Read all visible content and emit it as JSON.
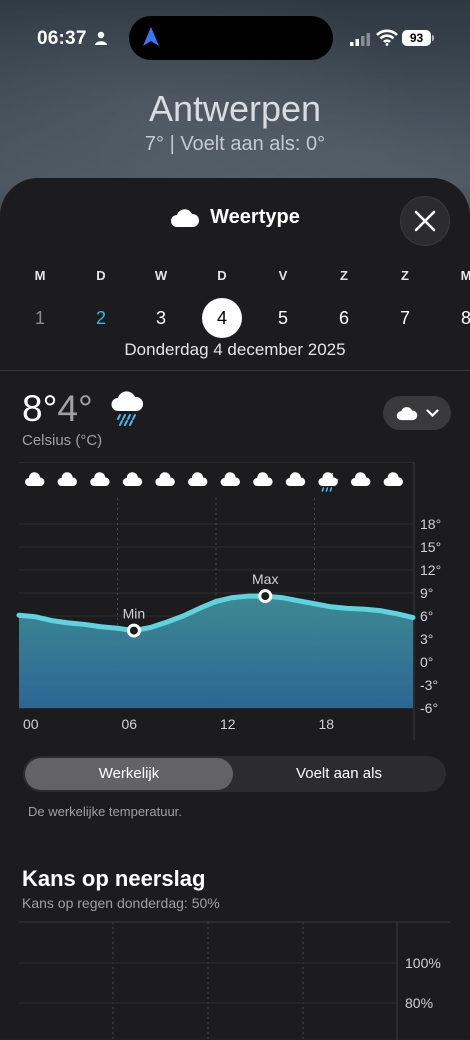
{
  "status": {
    "time": "06:37",
    "battery": "93"
  },
  "location": {
    "city": "Antwerpen",
    "summary": "7°  |  Voelt aan als: 0°"
  },
  "sheet": {
    "title": "Weertype",
    "close_icon": "close-icon"
  },
  "days": [
    {
      "letter": "M",
      "num": "1",
      "state": "past"
    },
    {
      "letter": "D",
      "num": "2",
      "state": "today"
    },
    {
      "letter": "W",
      "num": "3",
      "state": "normal"
    },
    {
      "letter": "D",
      "num": "4",
      "state": "selected"
    },
    {
      "letter": "V",
      "num": "5",
      "state": "normal"
    },
    {
      "letter": "Z",
      "num": "6",
      "state": "normal"
    },
    {
      "letter": "Z",
      "num": "7",
      "state": "normal"
    },
    {
      "letter": "M",
      "num": "8",
      "state": "normal"
    }
  ],
  "selected_date": "Donderdag 4 december 2025",
  "summary": {
    "max": "8°",
    "min": "4°",
    "unit": "Celsius (°C)",
    "condition_icon": "rain-cloud-icon"
  },
  "chart": {
    "hour_icons": [
      "cloud",
      "cloud",
      "cloud",
      "cloud",
      "cloud",
      "cloud",
      "cloud",
      "cloud",
      "cloud",
      "cloud-moon-rain",
      "cloud",
      "cloud"
    ],
    "y_ticks": [
      "18°",
      "15°",
      "12°",
      "9°",
      "6°",
      "3°",
      "0°",
      "-3°",
      "-6°"
    ],
    "x_ticks": [
      "00",
      "06",
      "12",
      "18"
    ],
    "min_label": "Min",
    "max_label": "Max",
    "accent": "#5fd3e0"
  },
  "chart_data": {
    "type": "area",
    "x": [
      0,
      1,
      2,
      3,
      4,
      5,
      6,
      7,
      8,
      9,
      10,
      11,
      12,
      13,
      14,
      15,
      16,
      17,
      18,
      19,
      20,
      21,
      22,
      23,
      24
    ],
    "y": [
      6.1,
      5.9,
      5.4,
      5.1,
      4.9,
      4.6,
      4.4,
      4.1,
      4.5,
      5.2,
      6.0,
      7.0,
      7.9,
      8.4,
      8.6,
      8.6,
      8.4,
      8.0,
      7.6,
      7.2,
      7.0,
      6.9,
      6.7,
      6.3,
      5.8
    ],
    "min_point": {
      "x": 7,
      "y": 4.1
    },
    "max_point": {
      "x": 15,
      "y": 8.6
    },
    "ylim": [
      -6,
      18
    ],
    "xlim": [
      0,
      24
    ]
  },
  "segment": {
    "active": "Werkelijk",
    "inactive": "Voelt aan als",
    "description": "De werkelijke temperatuur."
  },
  "precip": {
    "title": "Kans op neerslag",
    "subtitle": "Kans op regen donderdag: 50%",
    "y_ticks": [
      "100%",
      "80%"
    ]
  }
}
